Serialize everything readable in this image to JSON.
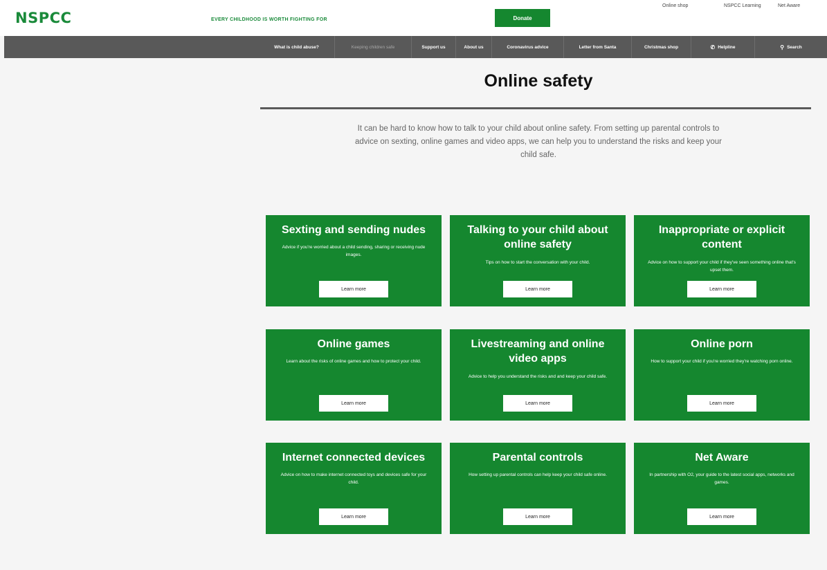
{
  "header": {
    "logo": "NSPCC",
    "tagline": "EVERY CHILDHOOD IS WORTH FIGHTING FOR",
    "donate_label": "Donate",
    "utility_links": [
      "Online shop",
      "NSPCC Learning",
      "Net Aware"
    ]
  },
  "nav": {
    "items": [
      "What is child abuse?",
      "Keeping children safe",
      "Support us",
      "About us",
      "Coronavirus advice",
      "Letter from Santa",
      "Christmas shop"
    ],
    "helpline_label": "Helpline",
    "search_label": "Search"
  },
  "main": {
    "title": "Online safety",
    "intro": "It can be hard to know how to talk to your child about online safety. From setting up parental controls to advice on sexting, online games and video apps, we can help you to understand the risks and keep your child safe."
  },
  "cards": [
    {
      "title": "Sexting and sending nudes",
      "desc": "Advice if you're worried about a child sending, sharing or receiving nude images.",
      "button": "Learn more"
    },
    {
      "title": "Talking to your child about online safety",
      "desc": "Tips on how to start the conversation with your child.",
      "button": "Learn more"
    },
    {
      "title": "Inappropriate or explicit content",
      "desc": "Advice on how to support your child if they've seen something online that's upset them.",
      "button": "Learn more"
    },
    {
      "title": "Online games",
      "desc": "Learn about the risks of online games and how to protect your child.",
      "button": "Learn more"
    },
    {
      "title": "Livestreaming and online video apps",
      "desc": "Advice to help you understand the risks and and keep your child safe.",
      "button": "Learn more"
    },
    {
      "title": "Online porn",
      "desc": "How to support your child if you're worried they're watching porn online.",
      "button": "Learn more"
    },
    {
      "title": "Internet connected devices",
      "desc": "Advice on how to make internet connected toys and devices safe for your child.",
      "button": "Learn more"
    },
    {
      "title": "Parental controls",
      "desc": "How setting up parental controls can help keep your child safe online.",
      "button": "Learn more"
    },
    {
      "title": "Net Aware",
      "desc": "In partnership with O2, your guide to the latest social apps, networks and games.",
      "button": "Learn more"
    }
  ],
  "colors": {
    "brand_green": "#15872f",
    "nav_grey": "#595959",
    "background": "#f5f5f5"
  }
}
